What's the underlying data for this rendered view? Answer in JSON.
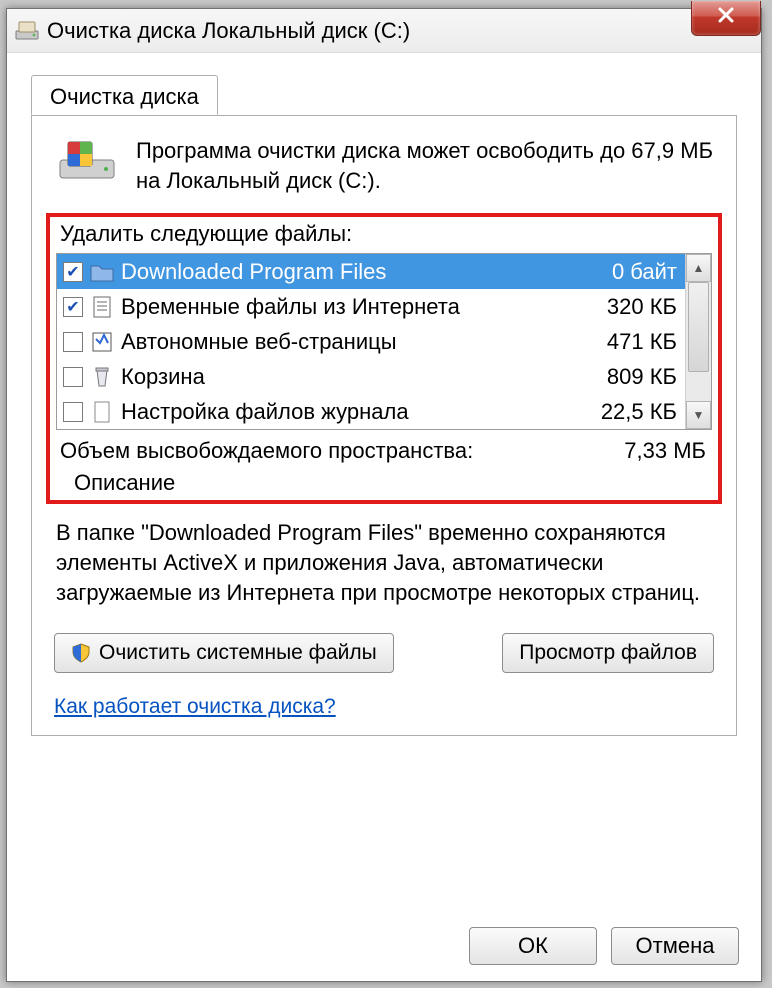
{
  "window": {
    "title": "Очистка диска Локальный диск  (C:)"
  },
  "tab": {
    "label": "Очистка диска"
  },
  "summary": {
    "text": "Программа очистки диска может освободить до 67,9 МБ на Локальный диск  (C:)."
  },
  "files": {
    "heading": "Удалить следующие файлы:",
    "items": [
      {
        "checked": true,
        "name": "Downloaded Program Files",
        "size": "0 байт",
        "selected": true,
        "icon": "folder-icon"
      },
      {
        "checked": true,
        "name": "Временные файлы из Интернета",
        "size": "320 КБ",
        "selected": false,
        "icon": "page-icon"
      },
      {
        "checked": false,
        "name": "Автономные веб-страницы",
        "size": "471 КБ",
        "selected": false,
        "icon": "web-icon"
      },
      {
        "checked": false,
        "name": "Корзина",
        "size": "809 КБ",
        "selected": false,
        "icon": "bin-icon"
      },
      {
        "checked": false,
        "name": "Настройка файлов журнала",
        "size": "22,5 КБ",
        "selected": false,
        "icon": "file-icon"
      }
    ]
  },
  "total": {
    "label": "Объем высвобождаемого пространства:",
    "value": "7,33 МБ"
  },
  "description": {
    "heading": "Описание",
    "text": "В папке \"Downloaded Program Files\" временно сохраняются элементы ActiveX и приложения Java, автоматически загружаемые из Интернета при просмотре некоторых страниц."
  },
  "actions": {
    "clean_system": "Очистить системные файлы",
    "view_files": "Просмотр файлов"
  },
  "link": {
    "text": "Как работает очистка диска?"
  },
  "buttons": {
    "ok": "ОК",
    "cancel": "Отмена"
  }
}
